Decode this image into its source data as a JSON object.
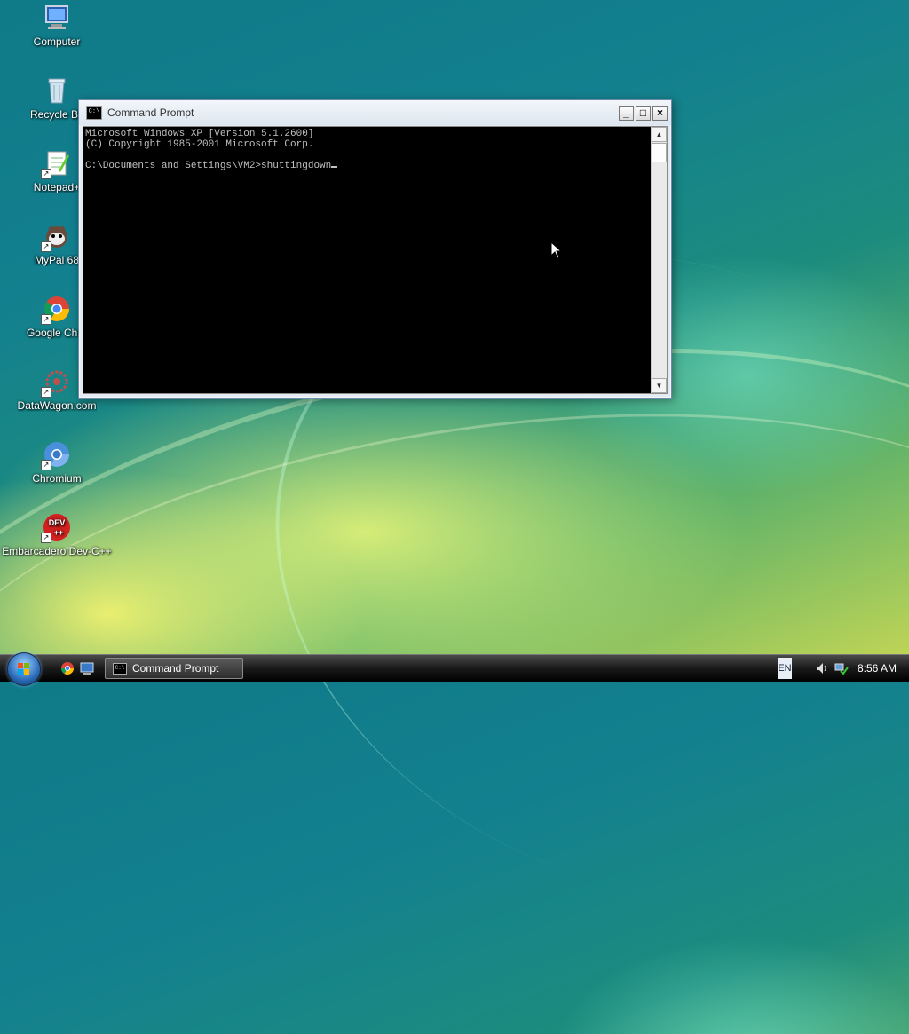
{
  "desktop": {
    "icons": [
      {
        "label": "Computer",
        "icon": "computer-icon"
      },
      {
        "label": "Recycle Bi",
        "icon": "recycle-bin-icon"
      },
      {
        "label": "Notepad+",
        "icon": "notepad-plus-icon"
      },
      {
        "label": "MyPal 68",
        "icon": "mypal-icon"
      },
      {
        "label": "Google Chro",
        "icon": "chrome-icon"
      },
      {
        "label": "DataWagon.com",
        "icon": "datawagon-icon"
      },
      {
        "label": "Chromium",
        "icon": "chromium-icon"
      },
      {
        "label": "Embarcadero Dev-C++",
        "icon": "devcpp-icon"
      }
    ]
  },
  "window": {
    "title": "Command Prompt",
    "console_lines": [
      "Microsoft Windows XP [Version 5.1.2600]",
      "(C) Copyright 1985-2001 Microsoft Corp.",
      "",
      "C:\\Documents and Settings\\VM2>shuttingdown"
    ],
    "icon_text": "C:\\",
    "minimize": "_",
    "maximize": "□",
    "close": "×"
  },
  "taskbar": {
    "task_button_label": "Command Prompt",
    "language": "EN",
    "clock": "8:56 AM"
  },
  "colors": {
    "console_bg": "#000000",
    "console_text": "#c0c0c0",
    "taskbar": "#1a1a1a"
  }
}
